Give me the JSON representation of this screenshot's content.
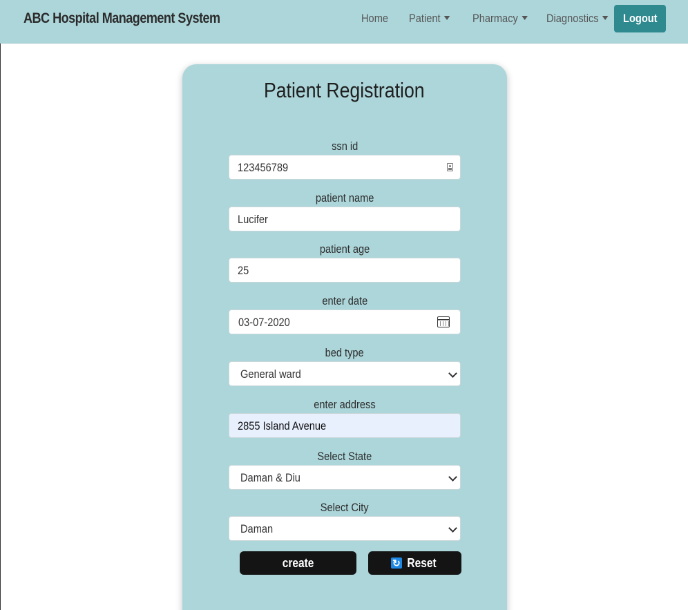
{
  "navbar": {
    "brand": "ABC Hospital Management System",
    "items": [
      "Home",
      "Patient",
      "Pharmacy",
      "Diagnostics"
    ],
    "logout_label": "Logout"
  },
  "form": {
    "title": "Patient Registration",
    "ssn_label": "ssn id",
    "ssn_value": "123456789",
    "name_label": "patient name",
    "name_value": "Lucifer",
    "age_label": "patient age",
    "age_value": "25",
    "date_label": "enter date",
    "date_value": "03-07-2020",
    "bed_label": "bed type",
    "bed_value": "General ward",
    "address_label": "enter address",
    "address_value": "2855 Island Avenue",
    "state_label": "Select State",
    "state_value": "Daman & Diu",
    "city_label": "Select City",
    "city_value": "Daman",
    "create_label": "create",
    "reset_label": "Reset"
  },
  "colors": {
    "navbar_bg": "#add6da",
    "card_bg": "#add6da",
    "logout_bg": "#2f8a90",
    "button_bg": "#141414",
    "autofill_bg": "#e8f0fe"
  },
  "icons": {
    "ssn_field": "id-card-icon",
    "date_field": "calendar-icon",
    "select": "chevron-down-icon",
    "reset_button": "refresh-icon"
  }
}
